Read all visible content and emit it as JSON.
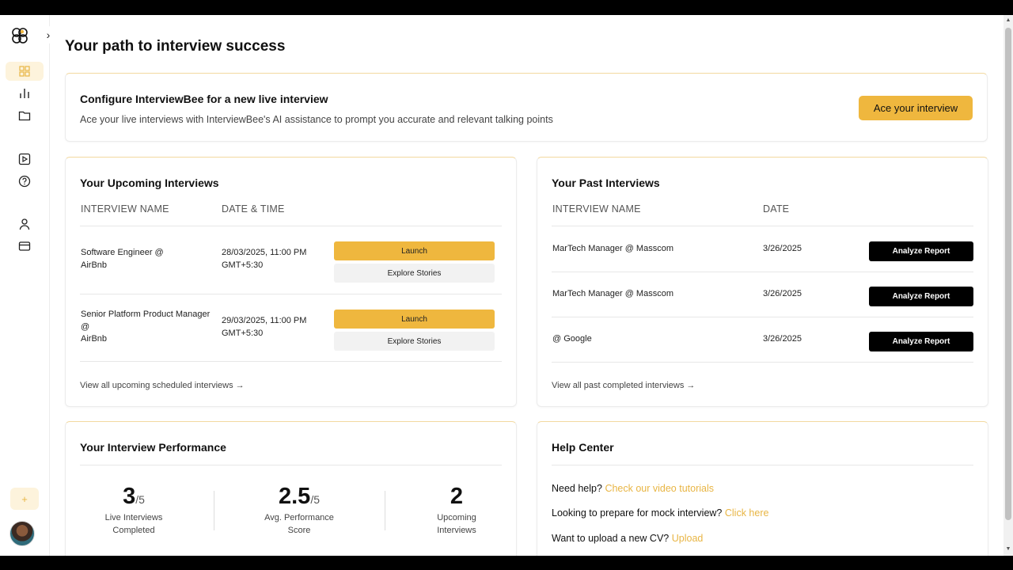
{
  "page": {
    "title": "Your path to interview success"
  },
  "colors": {
    "accent": "#efb73e",
    "accent_light": "#fdf3dc",
    "dark": "#000000"
  },
  "sidebar": {
    "expand_icon": "›",
    "plus_label": "+",
    "items": [
      {
        "icon": "grid-icon",
        "active": true
      },
      {
        "icon": "bar-chart-icon"
      },
      {
        "icon": "folder-icon"
      },
      {
        "icon": "play-square-icon"
      },
      {
        "icon": "help-circle-icon"
      },
      {
        "icon": "user-icon"
      },
      {
        "icon": "credit-card-icon"
      }
    ]
  },
  "config": {
    "title": "Configure InterviewBee for a new live interview",
    "description": "Ace your live interviews with InterviewBee's AI assistance to prompt you accurate and relevant talking points",
    "button": "Ace your interview"
  },
  "upcoming": {
    "title": "Your Upcoming Interviews",
    "col_name": "INTERVIEW NAME",
    "col_date": "DATE & TIME",
    "rows": [
      {
        "name_line1": "Software Engineer @",
        "name_line2": "AirBnb",
        "name_line3": "",
        "date_line1": "28/03/2025, 11:00 PM",
        "date_line2": "GMT+5:30",
        "launch": "Launch",
        "explore": "Explore Stories"
      },
      {
        "name_line1": "Senior Platform Product Manager",
        "name_line2": "@",
        "name_line3": "AirBnb",
        "date_line1": "29/03/2025, 11:00 PM",
        "date_line2": "GMT+5:30",
        "launch": "Launch",
        "explore": "Explore Stories"
      }
    ],
    "view_all": "View all upcoming scheduled interviews →"
  },
  "past": {
    "title": "Your Past Interviews",
    "col_name": "INTERVIEW NAME",
    "col_date": "DATE",
    "rows": [
      {
        "name": "MarTech Manager @ Masscom",
        "date": "3/26/2025",
        "action": "Analyze Report"
      },
      {
        "name": "MarTech Manager @ Masscom",
        "date": "3/26/2025",
        "action": "Analyze Report"
      },
      {
        "name": "@ Google",
        "date": "3/26/2025",
        "action": "Analyze Report"
      }
    ],
    "view_all": "View all past completed interviews →"
  },
  "performance": {
    "title": "Your Interview Performance",
    "stats": [
      {
        "value": "3",
        "denominator": "/5",
        "label_line1": "Live Interviews",
        "label_line2": "Completed"
      },
      {
        "value": "2.5",
        "denominator": "/5",
        "label_line1": "Avg. Performance",
        "label_line2": "Score"
      },
      {
        "value": "2",
        "denominator": "",
        "label_line1": "Upcoming",
        "label_line2": "Interviews"
      }
    ]
  },
  "help": {
    "title": "Help Center",
    "lines": [
      {
        "text": "Need help?",
        "link": "Check our video tutorials"
      },
      {
        "text": "Looking to prepare for mock interview?",
        "link": "Click here"
      },
      {
        "text": "Want to upload a new CV?",
        "link": "Upload"
      }
    ]
  }
}
